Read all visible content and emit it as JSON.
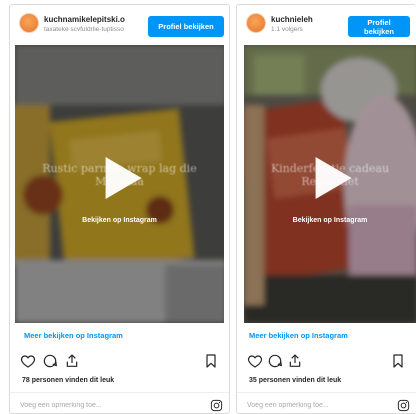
{
  "posts": [
    {
      "username": "kuchnamikelepitski.o",
      "subtitle": "taxateke scvfuldrlie-tuptisso",
      "follow_label": "Profiel bekijken",
      "overlay_caption": "Rustic parmen wrap lag die Massaaa",
      "watch_label": "Bekijken op Instagram",
      "more_link": "Meer bekijken op Instagram",
      "likes": "78 personen vinden dit leuk",
      "comment_placeholder": "Voeg een opmerking toe...",
      "icons": [
        "heart-icon",
        "comment-icon",
        "share-icon",
        "bookmark-icon",
        "instagram-icon"
      ]
    },
    {
      "username": "kuchnieleh",
      "subtitle": "1.1 volgers",
      "follow_label": "Profiel bekijken",
      "overlay_caption": "Kinderfeestje cadeau Regeo tiet",
      "watch_label": "Bekijken op Instagram",
      "more_link": "Meer bekijken op Instagram",
      "likes": "35 personen vinden dit leuk",
      "comment_placeholder": "Voeg een opmerking toe...",
      "icons": [
        "heart-icon",
        "comment-icon",
        "share-icon",
        "bookmark-icon",
        "instagram-icon"
      ]
    }
  ],
  "colors": {
    "accent": "#0095f6",
    "text": "#262626",
    "muted": "#8e8e8e",
    "border": "#dbdbdb"
  }
}
